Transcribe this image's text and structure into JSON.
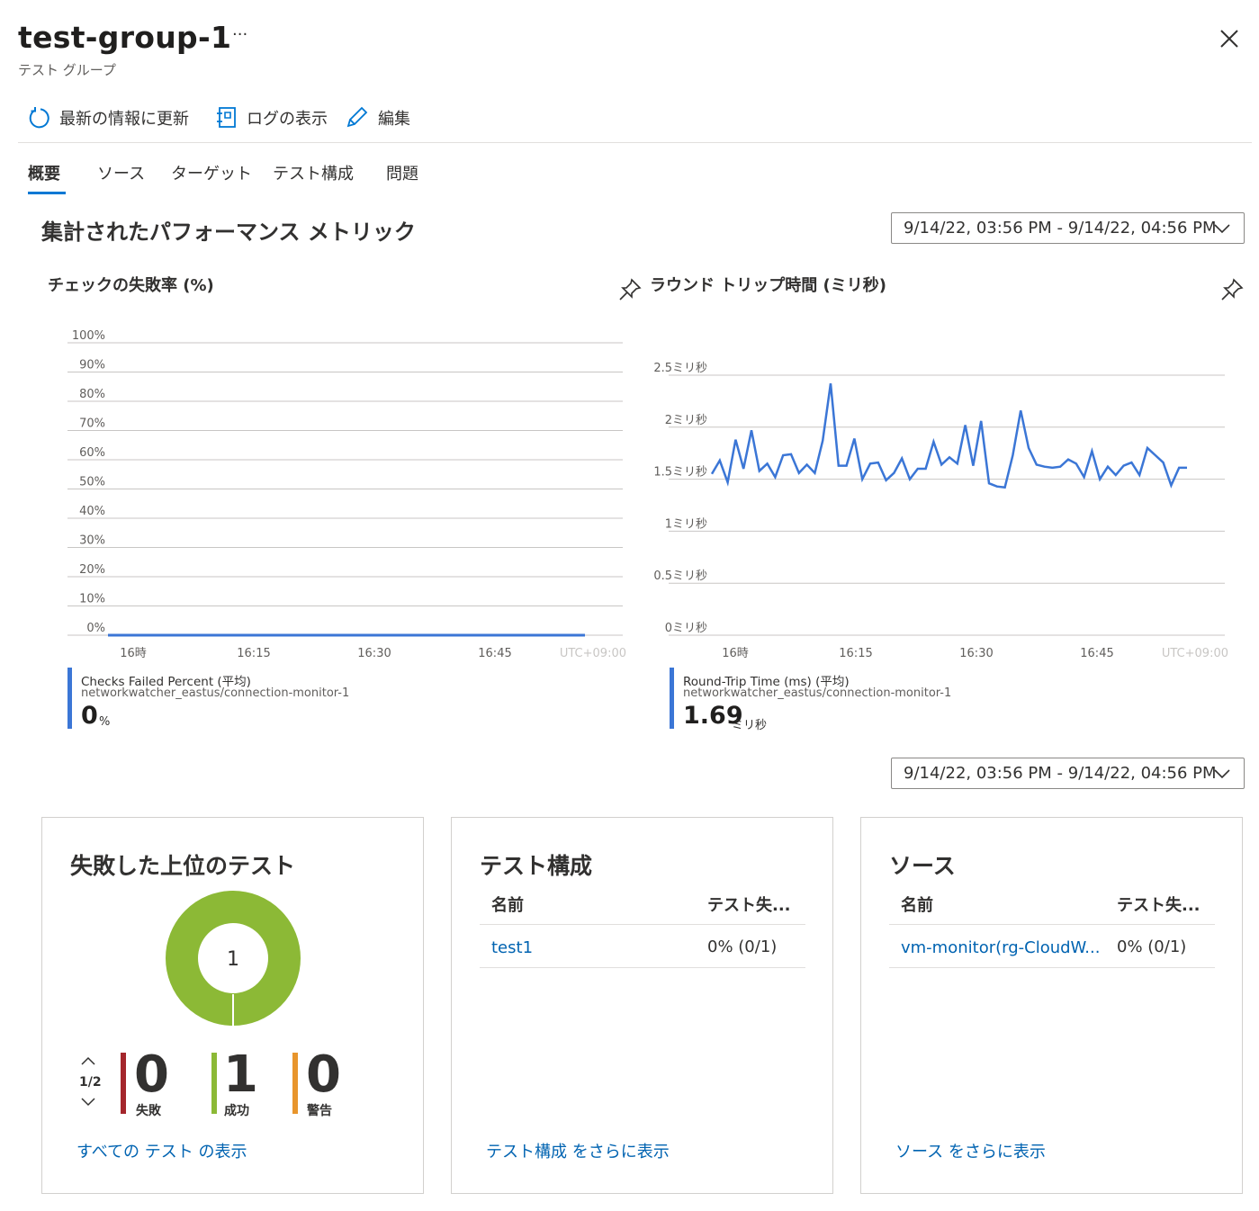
{
  "header": {
    "title": "test-group-1",
    "subtitle": "テスト グループ",
    "more": "···"
  },
  "toolbar": {
    "refresh": "最新の情報に更新",
    "logs": "ログの表示",
    "edit": "編集"
  },
  "tabs": [
    "概要",
    "ソース",
    "ターゲット",
    "テスト構成",
    "問題"
  ],
  "metrics": {
    "title": "集計されたパフォーマンス メトリック",
    "time_range": "9/14/22, 03:56 PM - 9/14/22, 04:56 PM"
  },
  "chart_failed": {
    "title": "チェックの失敗率 (%)",
    "legend_name": "Checks Failed Percent (平均)",
    "legend_source": "networkwatcher_eastus/connection-monitor-1",
    "value": "0",
    "unit": "%"
  },
  "chart_rtt": {
    "title": "ラウンド トリップ時間 (ミリ秒)",
    "legend_name": "Round-Trip Time (ms) (平均)",
    "legend_source": "networkwatcher_eastus/connection-monitor-1",
    "value": "1.69",
    "unit": "ミリ秒"
  },
  "chart_data": [
    {
      "type": "line",
      "title": "チェックの失敗率 (%)",
      "y_ticks": [
        "100%",
        "90%",
        "80%",
        "70%",
        "60%",
        "50%",
        "40%",
        "30%",
        "20%",
        "10%",
        "0%"
      ],
      "ylim": [
        0,
        100
      ],
      "x_ticks": [
        "16時",
        "16:15",
        "16:30",
        "16:45"
      ],
      "x_timezone": "UTC+09:00",
      "series": [
        {
          "name": "Checks Failed Percent (平均)",
          "color": "#3b76d6",
          "values": [
            0,
            0
          ]
        }
      ]
    },
    {
      "type": "line",
      "title": "ラウンド トリップ時間 (ミリ秒)",
      "y_ticks": [
        "2.5ミリ秒",
        "2ミリ秒",
        "1.5ミリ秒",
        "1ミリ秒",
        "0.5ミリ秒",
        "0ミリ秒"
      ],
      "ylim": [
        0,
        2.5
      ],
      "x_ticks": [
        "16時",
        "16:15",
        "16:30",
        "16:45"
      ],
      "x_timezone": "UTC+09:00",
      "series": [
        {
          "name": "Round-Trip Time (ms) (平均)",
          "color": "#3b76d6",
          "values": [
            1.55,
            1.68,
            1.47,
            1.88,
            1.6,
            1.97,
            1.58,
            1.65,
            1.52,
            1.73,
            1.74,
            1.56,
            1.64,
            1.56,
            1.87,
            2.42,
            1.63,
            1.63,
            1.89,
            1.5,
            1.65,
            1.66,
            1.49,
            1.56,
            1.7,
            1.5,
            1.6,
            1.6,
            1.86,
            1.64,
            1.71,
            1.65,
            2.02,
            1.63,
            2.06,
            1.46,
            1.43,
            1.42,
            1.73,
            2.16,
            1.8,
            1.64,
            1.62,
            1.61,
            1.62,
            1.69,
            1.65,
            1.52,
            1.77,
            1.5,
            1.62,
            1.54,
            1.63,
            1.66,
            1.54,
            1.8,
            1.73,
            1.66,
            1.44,
            1.61,
            1.61
          ]
        }
      ]
    }
  ],
  "time_range_2": "9/14/22, 03:56 PM - 9/14/22, 04:56 PM",
  "cards": {
    "failed_tests": {
      "title": "失敗した上位のテスト",
      "donut_value": "1",
      "donut": {
        "success": 1,
        "failed": 0,
        "warning": 0
      },
      "pager": "1/2",
      "stats": [
        {
          "value": "0",
          "label": "失敗",
          "color": "#a4262c"
        },
        {
          "value": "1",
          "label": "成功",
          "color": "#8cb936"
        },
        {
          "value": "0",
          "label": "警告",
          "color": "#e8952c"
        }
      ],
      "link": "すべての テスト の表示"
    },
    "test_config": {
      "title": "テスト構成",
      "col_name": "名前",
      "col_fail": "テスト失...",
      "rows": [
        {
          "name": "test1",
          "fail": "0% (0/1)"
        }
      ],
      "link": "テスト構成 をさらに表示"
    },
    "sources": {
      "title": "ソース",
      "col_name": "名前",
      "col_fail": "テスト失...",
      "rows": [
        {
          "name": "vm-monitor(rg-CloudW...",
          "fail": "0% (0/1)"
        }
      ],
      "link": "ソース をさらに表示"
    }
  }
}
